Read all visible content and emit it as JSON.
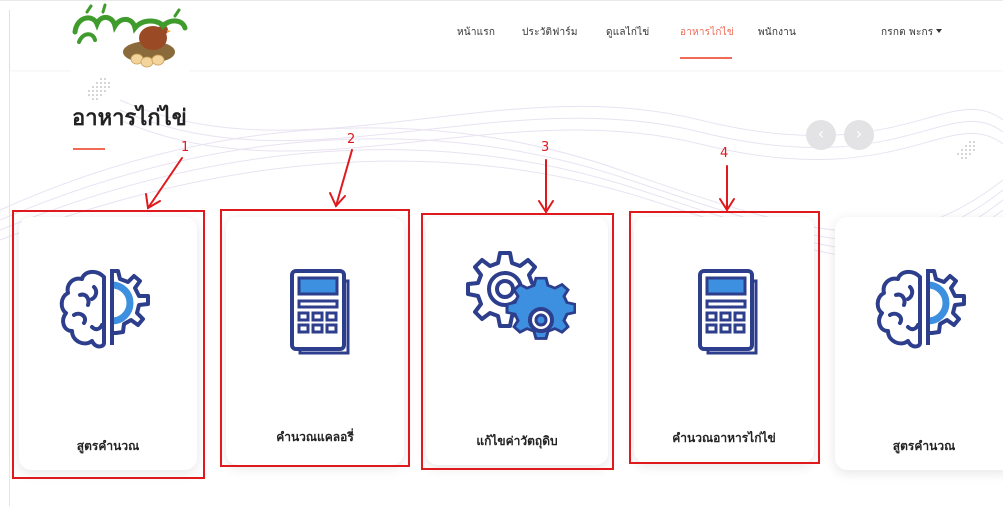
{
  "nav": {
    "items": [
      {
        "label": "หน้าแรก",
        "active": false
      },
      {
        "label": "ประวัติฟาร์ม",
        "active": false
      },
      {
        "label": "ดูแลไก่ไข่",
        "active": false
      },
      {
        "label": "อาหารไก่ไข่",
        "active": true
      },
      {
        "label": "พนักงาน",
        "active": false
      }
    ],
    "user": "กรกต พะกร"
  },
  "page": {
    "title": "อาหารไก่ไข่"
  },
  "cards": [
    {
      "label": "สูตรคำนวณ",
      "icon": "brain-gear-icon"
    },
    {
      "label": "คำนวณแคลอรี่",
      "icon": "calculator-icon"
    },
    {
      "label": "แก้ไขค่าวัตถุดิบ",
      "icon": "gears-icon"
    },
    {
      "label": "คำนวณอาหารไก่ไข่",
      "icon": "calculator-icon"
    },
    {
      "label": "สูตรคำนวณ",
      "icon": "brain-gear-icon"
    }
  ],
  "carousel": {
    "prev": "‹",
    "next": "›"
  },
  "annotations": [
    "1",
    "2",
    "3",
    "4"
  ],
  "colors": {
    "accent": "#f06a56",
    "icon_blue": "#2c3e8c",
    "icon_light": "#3d8fe0",
    "annotation_red": "#e0191d"
  }
}
